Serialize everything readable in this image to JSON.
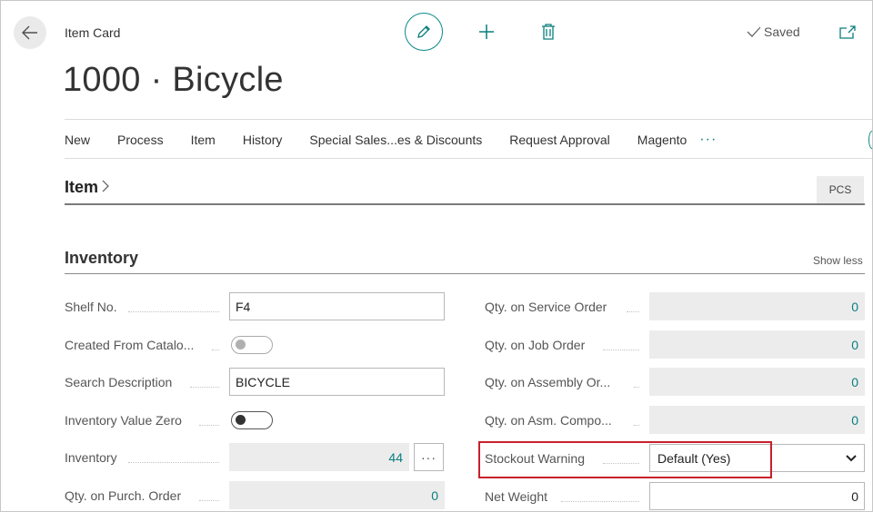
{
  "header": {
    "page_label": "Item Card",
    "title": "1000 · Bicycle",
    "saved_label": "Saved"
  },
  "actions": [
    "New",
    "Process",
    "Item",
    "History",
    "Special Sales...es & Discounts",
    "Request Approval",
    "Magento"
  ],
  "more_label": "···",
  "item_section": {
    "title": "Item",
    "badge": "PCS"
  },
  "inventory": {
    "title": "Inventory",
    "toggle_label": "Show less",
    "left_fields": [
      {
        "label": "Shelf No.",
        "value": "F4"
      },
      {
        "label": "Created From Catalo...",
        "value": false
      },
      {
        "label": "Search Description",
        "value": "BICYCLE"
      },
      {
        "label": "Inventory Value Zero",
        "value": false
      },
      {
        "label": "Inventory",
        "value": "44",
        "assist": "···"
      },
      {
        "label": "Qty. on Purch. Order",
        "value": "0"
      }
    ],
    "right_fields": [
      {
        "label": "Qty. on Service Order",
        "value": "0"
      },
      {
        "label": "Qty. on Job Order",
        "value": "0"
      },
      {
        "label": "Qty. on Assembly Or...",
        "value": "0"
      },
      {
        "label": "Qty. on Asm. Compo...",
        "value": "0"
      },
      {
        "label": "Stockout Warning",
        "value": "Default (Yes)"
      },
      {
        "label": "Net Weight",
        "value": "0"
      }
    ]
  },
  "colors": {
    "accent": "#0a7e7e",
    "highlight": "#c8202b"
  },
  "icons": [
    "back-arrow-icon",
    "pencil-icon",
    "plus-icon",
    "trash-icon",
    "checkmark-icon",
    "popout-icon",
    "chevron-right-icon",
    "chevron-down-icon"
  ]
}
